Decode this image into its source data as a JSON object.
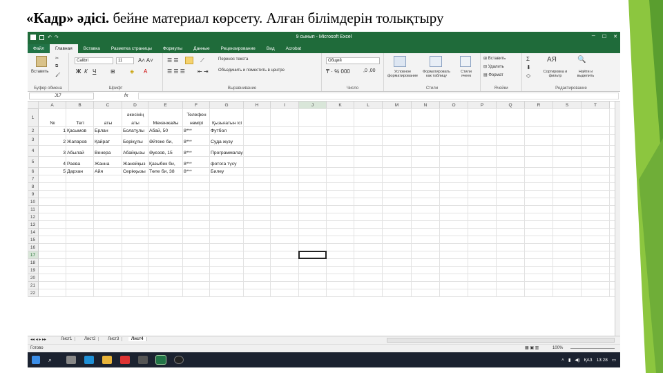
{
  "slide": {
    "title_bold": "«Кадр» әдісі.",
    "title_rest": " бейне материал көрсету. Алған білімдерін толықтыру"
  },
  "excel": {
    "window_title": "9 сынып - Microsoft Excel",
    "tabs": [
      "Файл",
      "Главная",
      "Вставка",
      "Разметка страницы",
      "Формулы",
      "Данные",
      "Рецензирование",
      "Вид",
      "Acrobat"
    ],
    "ribbon": {
      "paste": "Вставить",
      "clipboard": "Буфер обмена",
      "font_name": "Calibri",
      "font_size": "11",
      "font_group": "Шрифт",
      "wrap": "Перенос текста",
      "merge": "Объединить и поместить в центре",
      "align_group": "Выравнивание",
      "number_format": "Общий",
      "number_group": "Число",
      "cond_format": "Условное форматирование",
      "format_table": "Форматировать как таблицу",
      "cell_styles": "Стили ячеек",
      "styles_group": "Стили",
      "insert": "Вставить",
      "delete": "Удалить",
      "format": "Формат",
      "cells_group": "Ячейки",
      "sort": "Сортировка и фильтр",
      "find": "Найти и выделить",
      "editing_group": "Редактирование"
    },
    "name_box": "J17",
    "fx": "fx",
    "columns": [
      "A",
      "B",
      "C",
      "D",
      "E",
      "F",
      "G",
      "H",
      "I",
      "J",
      "K",
      "L",
      "M",
      "N",
      "O",
      "P",
      "Q",
      "R",
      "S",
      "T"
    ],
    "rows": [
      "1",
      "2",
      "3",
      "4",
      "5",
      "6",
      "7",
      "8",
      "9",
      "10",
      "11",
      "12",
      "13",
      "14",
      "15",
      "16",
      "17",
      "18",
      "19",
      "20",
      "21",
      "22"
    ],
    "headers": {
      "a": "№",
      "b": "Тегі",
      "c": "аты",
      "d1": "әкесінің",
      "d2": "аты",
      "e": "Мекенжайы",
      "f1": "Телефон",
      "f2": "нөмірі",
      "g": "Қызығатын ісі"
    },
    "data": [
      {
        "n": "1",
        "surname": "Қасымов",
        "name": "Ерлан",
        "patr": "Болатұлы",
        "addr": "Абай, 50",
        "phone": "8***",
        "hobby": "Футбол"
      },
      {
        "n": "2",
        "surname": "Жапаров",
        "name": "Қайрат",
        "patr": "Берікұлы",
        "addr": "Әйтеке би,",
        "phone": "8***",
        "hobby": "Суда жүзу"
      },
      {
        "n": "3",
        "surname": "Абылай",
        "name": "Венера",
        "patr": "Абайқызы",
        "addr": "Әуезов, 15",
        "phone": "8***",
        "hobby": "Программалау"
      },
      {
        "n": "4",
        "surname": "Раева",
        "name": "Жанна",
        "patr": "Жанейқыз",
        "addr": "Қазыбек би,",
        "phone": "8***",
        "hobby": "фотоға түсу"
      },
      {
        "n": "5",
        "surname": "Дархан",
        "name": "Айя",
        "patr": "Серікқызы",
        "addr": "Төле би, 38",
        "phone": "8***",
        "hobby": "Билеу"
      }
    ],
    "sheet_tabs": [
      "Лист1",
      "Лист2",
      "Лист3",
      "Лист4"
    ],
    "status": "Готово",
    "zoom": "100%",
    "clock_time": "13:28",
    "lang": "ҚАЗ",
    "colors": {
      "excel_green": "#217346",
      "slide_green": "#7ab648"
    }
  }
}
